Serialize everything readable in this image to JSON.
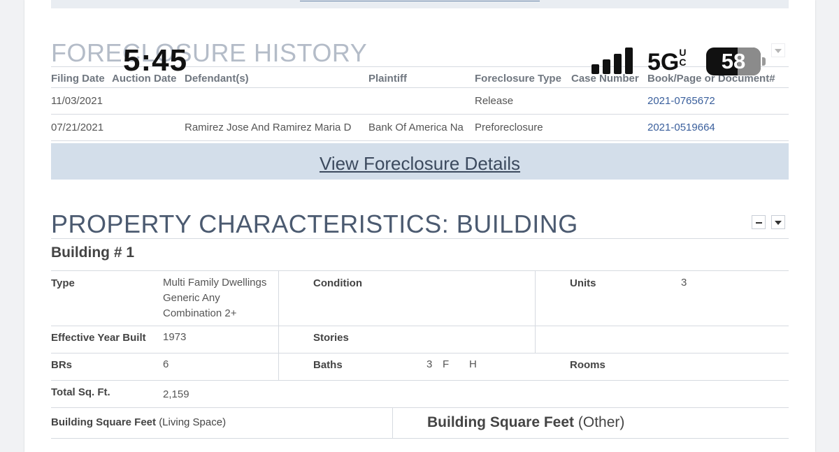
{
  "status_bar": {
    "time": "5:45",
    "network": "5G",
    "network_sup": "UC",
    "battery": "58"
  },
  "foreclosure": {
    "title": "FORECLOSURE HISTORY",
    "headers": [
      "Filing Date",
      "Auction Date",
      "Defendant(s)",
      "Plaintiff",
      "Foreclosure Type",
      "Case Number",
      "Book/Page or Document#"
    ],
    "rows": [
      {
        "filing_date": "11/03/2021",
        "auction_date": "",
        "defendants": "",
        "plaintiff": "",
        "type": "Release",
        "case_number": "",
        "document": "2021-0765672"
      },
      {
        "filing_date": "07/21/2021",
        "auction_date": "",
        "defendants": "Ramirez Jose And Ramirez Maria D",
        "plaintiff": "Bank Of America Na",
        "type": "Preforeclosure",
        "case_number": "",
        "document": "2021-0519664"
      }
    ],
    "view_details_label": "View Foreclosure Details"
  },
  "building": {
    "title": "PROPERTY CHARACTERISTICS: BUILDING",
    "subtitle": "Building # 1",
    "type_label": "Type",
    "type_value": "Multi Family Dwellings Generic Any Combination 2+",
    "condition_label": "Condition",
    "condition_value": "",
    "units_label": "Units",
    "units_value": "3",
    "eff_year_label": "Effective Year Built",
    "eff_year_value": "1973",
    "stories_label": "Stories",
    "stories_value": "",
    "brs_label": "BRs",
    "brs_value": "6",
    "baths_label": "Baths",
    "baths_value": "3",
    "baths_f": "F",
    "baths_h": "H",
    "rooms_label": "Rooms",
    "rooms_value": "",
    "sqft_label": "Total Sq. Ft.",
    "sqft_value": "2,159",
    "bsf_living_label": "Building Square Feet",
    "bsf_living_suffix": "(Living Space)",
    "bsf_other_label": "Building Square Feet",
    "bsf_other_suffix": "(Other)"
  }
}
